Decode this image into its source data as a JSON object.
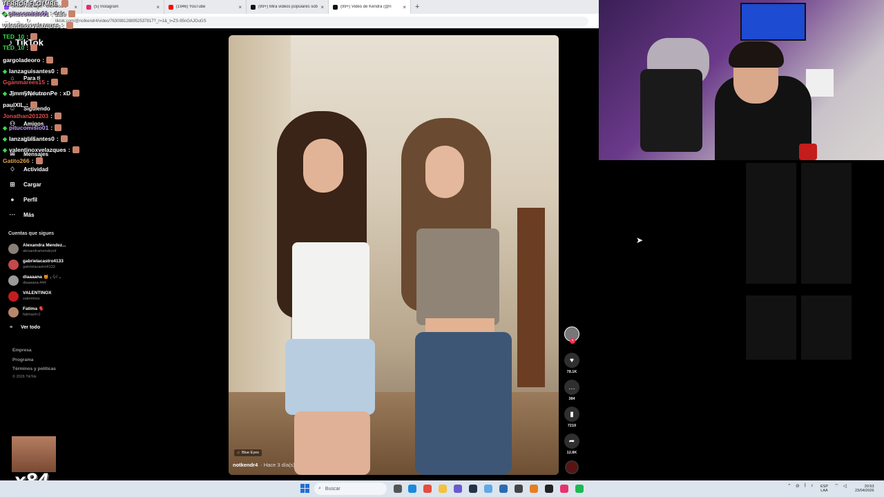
{
  "browser": {
    "tabs": [
      {
        "label": "Stream Manager - Dashboard",
        "color": "#9146ff",
        "active": false
      },
      {
        "label": "(5) Instagram",
        "color": "#e1306c",
        "active": false
      },
      {
        "label": "(1946) YouTube",
        "color": "#ff0000",
        "active": false
      },
      {
        "label": "(99+) Mira videos populares sob",
        "color": "#111111",
        "active": false
      },
      {
        "label": "(99+) Video de Kendra (@n",
        "color": "#111111",
        "active": true
      }
    ],
    "url": "tiktok.com/@notkendr4/video/7630981288952537817?_r=1&_t=ZS-95nGAJOuGS"
  },
  "tiktok": {
    "logo": "TikTok",
    "nav": [
      {
        "label": "Para ti",
        "icon": "home-icon",
        "glyph": "⌂"
      },
      {
        "label": "Explorar",
        "icon": "compass-icon",
        "glyph": "◎"
      },
      {
        "label": "Siguiendo",
        "icon": "following-icon",
        "glyph": "☺"
      },
      {
        "label": "Amigos",
        "icon": "friends-icon",
        "glyph": "⚇"
      },
      {
        "label": "LIVE",
        "icon": "live-icon",
        "glyph": "▭"
      },
      {
        "label": "Mensajes",
        "icon": "message-icon",
        "glyph": "✉"
      },
      {
        "label": "Actividad",
        "icon": "activity-icon",
        "glyph": "♢"
      },
      {
        "label": "Cargar",
        "icon": "upload-icon",
        "glyph": "⊞"
      },
      {
        "label": "Perfil",
        "icon": "profile-icon",
        "glyph": "●"
      },
      {
        "label": "Más",
        "icon": "more-icon",
        "glyph": "···"
      }
    ],
    "following_title": "Cuentas que sigues",
    "following": [
      {
        "name": "Alexandra Mendez...",
        "handle": "alexandramendezof",
        "color": "#8a7f76"
      },
      {
        "name": "gabrielacastro4133",
        "handle": "gabrielacastro4133",
        "color": "#c24a4a"
      },
      {
        "name": "diaaaana 🍯 . 🎶 .",
        "handle": "diaaaana.444",
        "color": "#9a9a9a"
      },
      {
        "name": "VALENTINOX",
        "handle": "valentinox",
        "color": "#c21d1d"
      },
      {
        "name": "Fatima 🫀",
        "handle": "fatimaxh.0",
        "color": "#b8876b"
      }
    ],
    "see_all": "Ver todo",
    "footer": [
      "Empresa",
      "Programa",
      "Términos y políticas"
    ],
    "copyright": "© 2026 TikTok"
  },
  "chat": [
    {
      "user": "TERROR FLGTMRE",
      "color": "#ffffff",
      "msg": "",
      "badge": false
    },
    {
      "user": "pitucomisio01",
      "color": "#c9a0ff",
      "msg": ": dale",
      "badge": true
    },
    {
      "user": "valentinoxvelazques",
      "color": "#ffffff",
      "msg": ":",
      "badge": false
    },
    {
      "user": "TED_10",
      "color": "#3bd94a",
      "msg": ":",
      "badge": false
    },
    {
      "user": "TED_10",
      "color": "#3bd94a",
      "msg": ":",
      "badge": false
    },
    {
      "user": "gargoladeoro",
      "color": "#ffffff",
      "msg": ":",
      "badge": false
    },
    {
      "user": "lanzaguisantes0",
      "color": "#ffffff",
      "msg": ":",
      "badge": true
    },
    {
      "user": "Gganmarees15",
      "color": "#e04a4a",
      "msg": ":",
      "badge": false
    },
    {
      "user": "JimmyNeutronPe",
      "color": "#ffffff",
      "msg": ": xD",
      "badge": true
    },
    {
      "user": "paulXIL",
      "color": "#ffffff",
      "msg": ":",
      "badge": false
    },
    {
      "user": "Jonathan201203",
      "color": "#e04a4a",
      "msg": ":",
      "badge": false
    },
    {
      "user": "pitucomisio01",
      "color": "#c9a0ff",
      "msg": ":",
      "badge": true
    },
    {
      "user": "lanzaguisantes0",
      "color": "#ffffff",
      "msg": ":",
      "badge": true
    },
    {
      "user": "valentinoxvelazques",
      "color": "#ffffff",
      "msg": ":",
      "badge": true
    },
    {
      "user": "Gatito266",
      "color": "#e0a04a",
      "msg": ":",
      "badge": false
    }
  ],
  "video": {
    "music": "Blue Eyes",
    "author": "notkendr4",
    "posted": "· Hace 3 día(s)"
  },
  "actions": {
    "likes": "78.1K",
    "comments": "384",
    "saves": "7219",
    "shares": "12.8K"
  },
  "sub_count": "x84",
  "taskbar": {
    "search_placeholder": "Buscar",
    "lang": "ESP",
    "lang2": "LAA",
    "time": "20:53",
    "date": "23/04/2026"
  }
}
